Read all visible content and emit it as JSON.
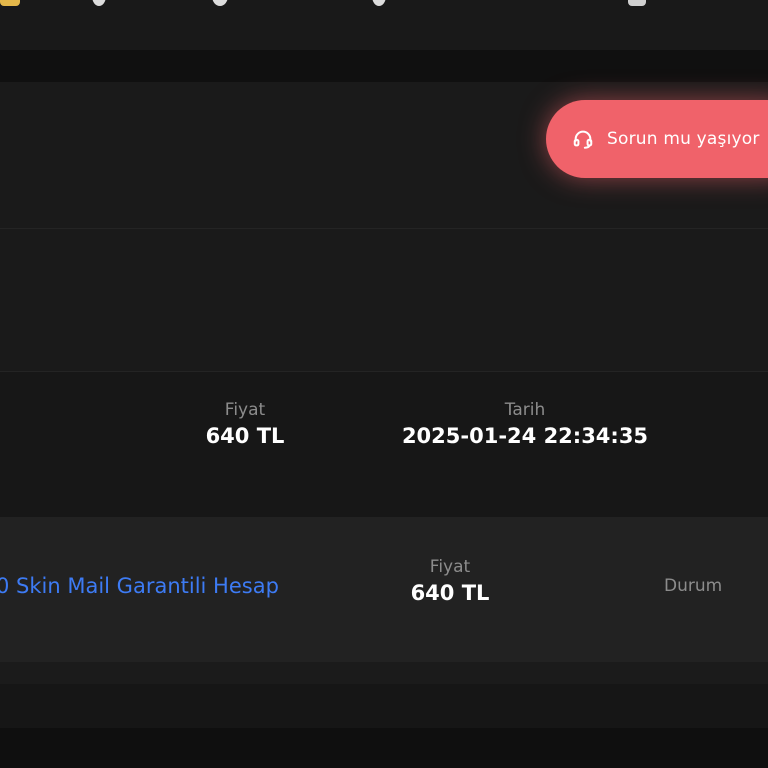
{
  "colors": {
    "background": "#141414",
    "accent": "#f0626a",
    "link": "#3d7bf4",
    "muted_label": "#8c8c8c"
  },
  "help": {
    "label": "Sorun mu yaşıyor",
    "icon": "headset-icon"
  },
  "order": {
    "price_label": "Fiyat",
    "price_value": "640 TL",
    "date_label": "Tarih",
    "date_value": "2025-01-24 22:34:35"
  },
  "product": {
    "name": "0 Skin Mail Garantili Hesap",
    "price_label": "Fiyat",
    "price_value": "640 TL",
    "status_label": "Durum"
  }
}
